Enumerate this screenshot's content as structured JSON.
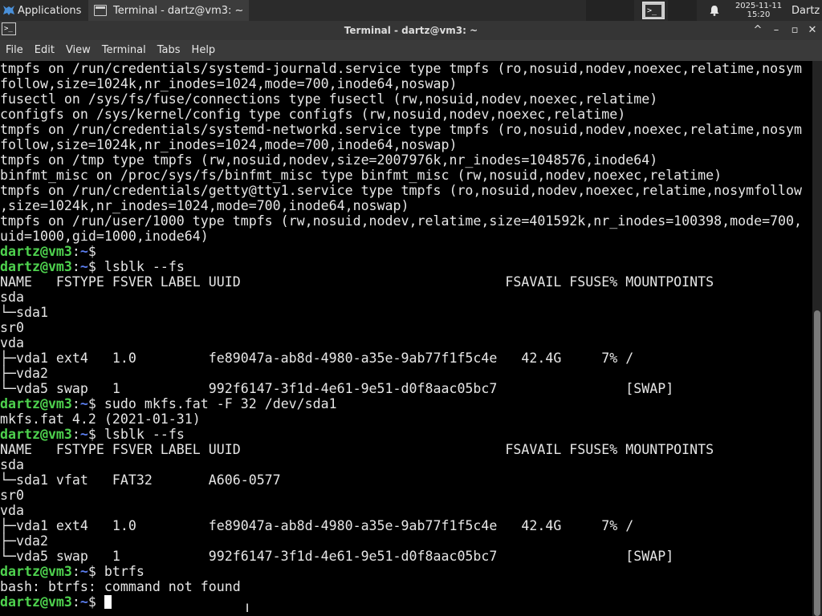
{
  "panel": {
    "apps_label": "Applications",
    "task_label": "Terminal - dartz@vm3: ~",
    "clock_date": "2025-11-11",
    "clock_time": "15:20",
    "user": "Dartz"
  },
  "window": {
    "title": "Terminal - dartz@vm3: ~",
    "minimize": "^",
    "restore": "–",
    "maximize": "▫",
    "close": "✕"
  },
  "menubar": {
    "items": [
      "File",
      "Edit",
      "View",
      "Terminal",
      "Tabs",
      "Help"
    ]
  },
  "prompt": {
    "user": "dartz@vm3",
    "sep": ":",
    "path": "~",
    "symbol": "$ "
  },
  "terminal": {
    "lines": [
      {
        "text": "tmpfs on /run/credentials/systemd-journald.service type tmpfs (ro,nosuid,nodev,noexec,relatime,nosym"
      },
      {
        "text": "follow,size=1024k,nr_inodes=1024,mode=700,inode64,noswap)"
      },
      {
        "text": "fusectl on /sys/fs/fuse/connections type fusectl (rw,nosuid,nodev,noexec,relatime)"
      },
      {
        "text": "configfs on /sys/kernel/config type configfs (rw,nosuid,nodev,noexec,relatime)"
      },
      {
        "text": "tmpfs on /run/credentials/systemd-networkd.service type tmpfs (ro,nosuid,nodev,noexec,relatime,nosym"
      },
      {
        "text": "follow,size=1024k,nr_inodes=1024,mode=700,inode64,noswap)"
      },
      {
        "text": "tmpfs on /tmp type tmpfs (rw,nosuid,nodev,size=2007976k,nr_inodes=1048576,inode64)"
      },
      {
        "text": "binfmt_misc on /proc/sys/fs/binfmt_misc type binfmt_misc (rw,nosuid,nodev,noexec,relatime)"
      },
      {
        "text": "tmpfs on /run/credentials/getty@tty1.service type tmpfs (ro,nosuid,nodev,noexec,relatime,nosymfollow"
      },
      {
        "text": ",size=1024k,nr_inodes=1024,mode=700,inode64,noswap)"
      },
      {
        "text": "tmpfs on /run/user/1000 type tmpfs (rw,nosuid,nodev,relatime,size=401592k,nr_inodes=100398,mode=700,"
      },
      {
        "text": "uid=1000,gid=1000,inode64)"
      },
      {
        "prompt": true,
        "text": ""
      },
      {
        "prompt": true,
        "text": "lsblk --fs"
      },
      {
        "text": "NAME   FSTYPE FSVER LABEL UUID                                 FSAVAIL FSUSE% MOUNTPOINTS"
      },
      {
        "text": "sda"
      },
      {
        "text": "└─sda1"
      },
      {
        "text": "sr0"
      },
      {
        "text": "vda"
      },
      {
        "text": "├─vda1 ext4   1.0         fe89047a-ab8d-4980-a35e-9ab77f1f5c4e   42.4G     7% /"
      },
      {
        "text": "├─vda2"
      },
      {
        "text": "└─vda5 swap   1           992f6147-3f1d-4e61-9e51-d0f8aac05bc7                [SWAP]"
      },
      {
        "prompt": true,
        "text": "sudo mkfs.fat -F 32 /dev/sda1"
      },
      {
        "text": "mkfs.fat 4.2 (2021-01-31)"
      },
      {
        "prompt": true,
        "text": "lsblk --fs"
      },
      {
        "text": "NAME   FSTYPE FSVER LABEL UUID                                 FSAVAIL FSUSE% MOUNTPOINTS"
      },
      {
        "text": "sda"
      },
      {
        "text": "└─sda1 vfat   FAT32       A606-0577"
      },
      {
        "text": "sr0"
      },
      {
        "text": "vda"
      },
      {
        "text": "├─vda1 ext4   1.0         fe89047a-ab8d-4980-a35e-9ab77f1f5c4e   42.4G     7% /"
      },
      {
        "text": "├─vda2"
      },
      {
        "text": "└─vda5 swap   1           992f6147-3f1d-4e61-9e51-d0f8aac05bc7                [SWAP]"
      },
      {
        "prompt": true,
        "text": "btrfs"
      },
      {
        "text": "bash: btrfs: command not found"
      },
      {
        "prompt": true,
        "text": "",
        "cursor": true
      }
    ]
  },
  "icons": {
    "apps": "xfce-mouse-icon",
    "task": "terminal-icon",
    "launcher": "terminal-launcher-icon",
    "bell": "bell-icon"
  },
  "colors": {
    "prompt_user": "#4ed24e",
    "prompt_path": "#5b7ef0",
    "panel_bg": "#2b2b2b",
    "terminal_bg": "#000000"
  }
}
